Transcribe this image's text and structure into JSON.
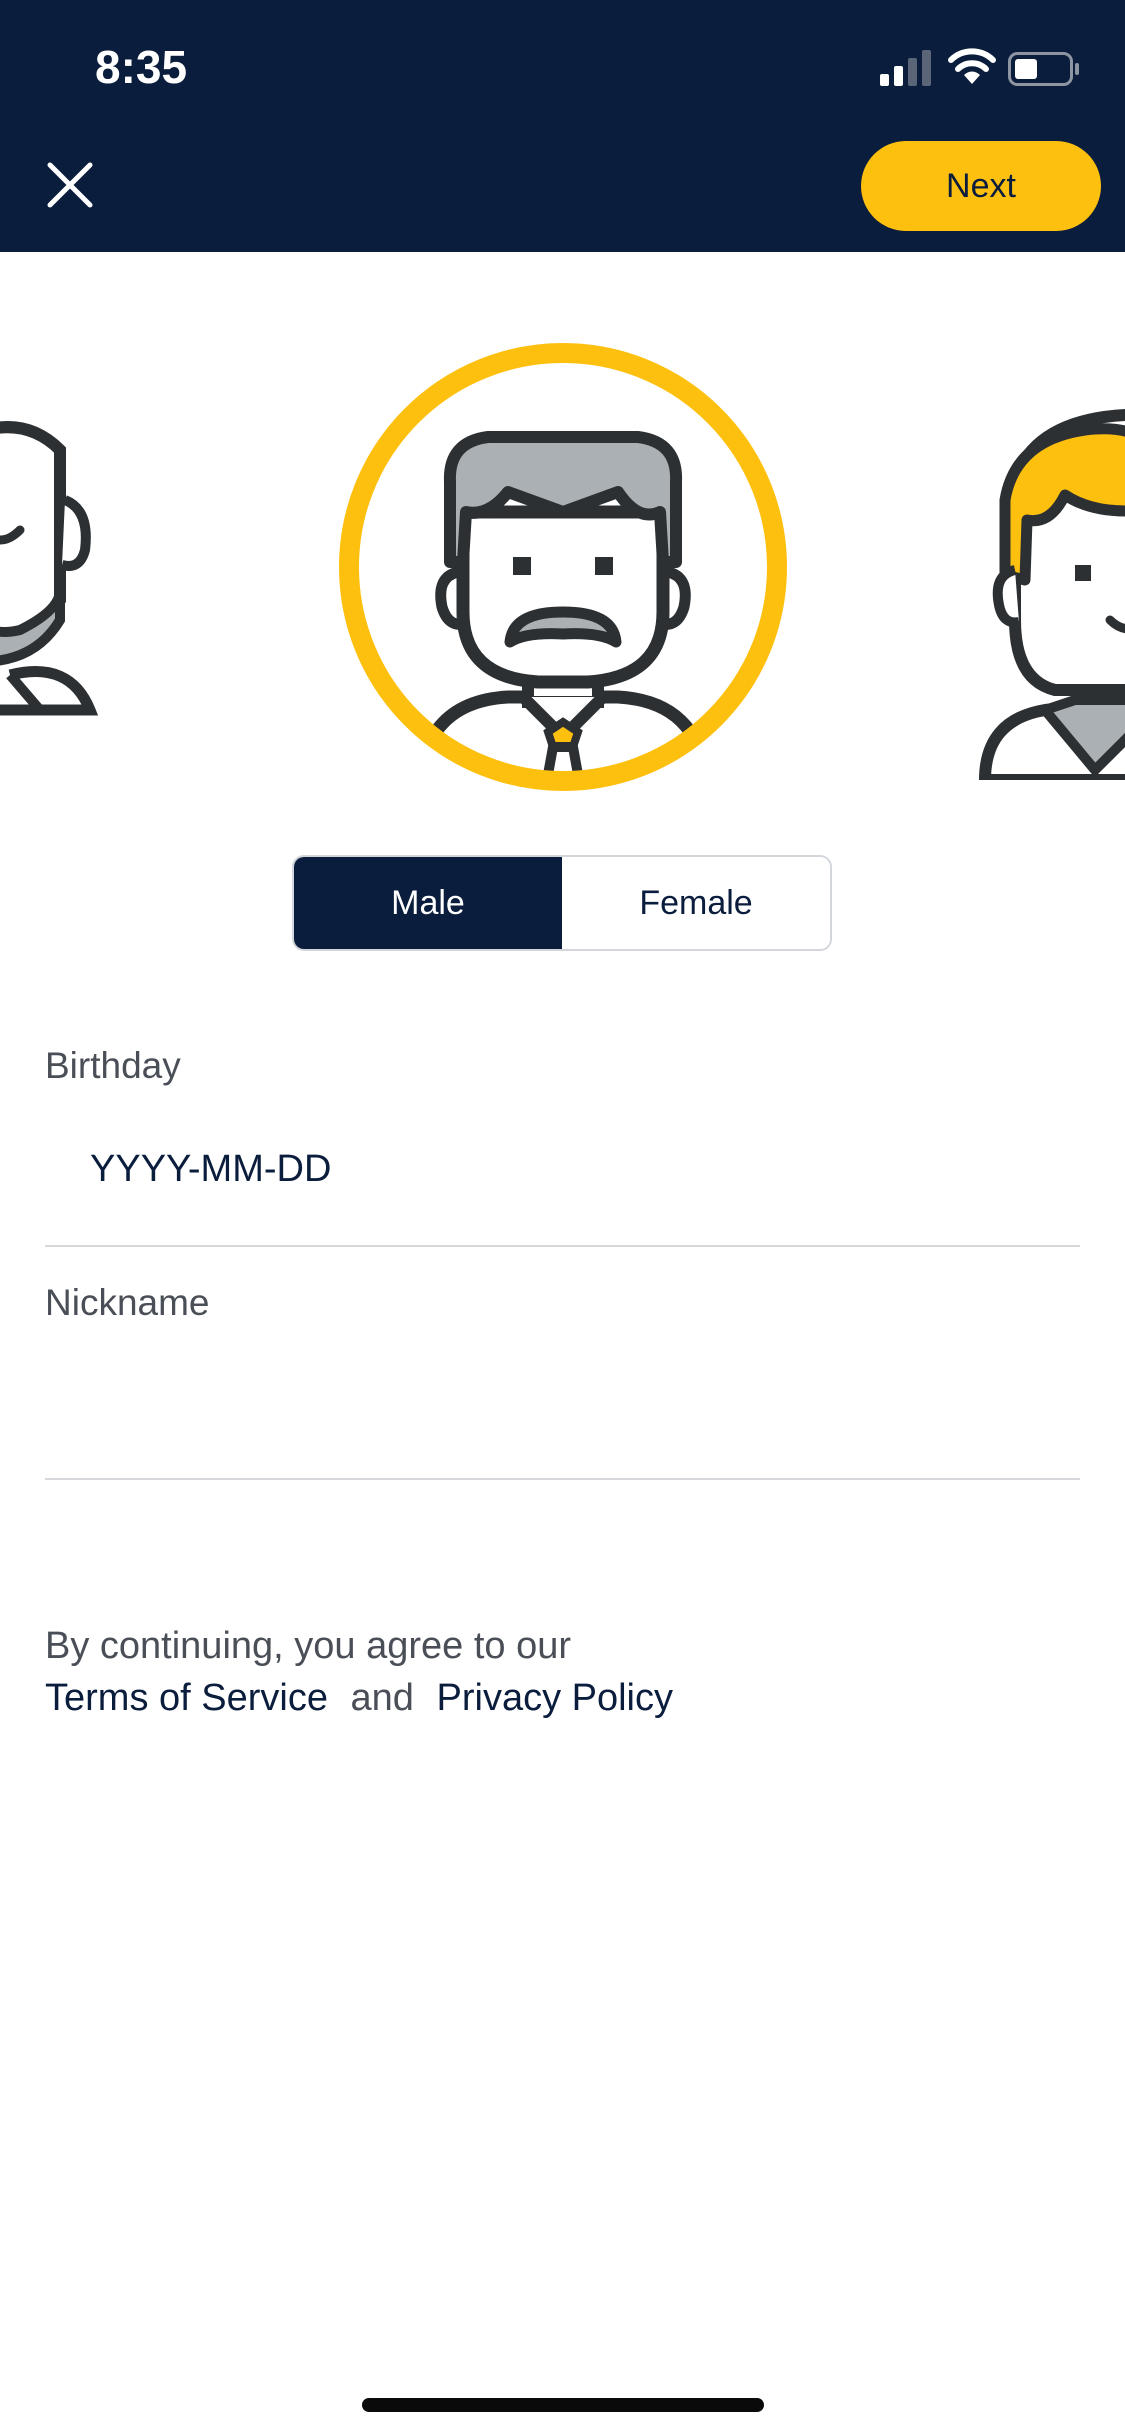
{
  "status_bar": {
    "time": "8:35"
  },
  "header": {
    "next_label": "Next"
  },
  "colors": {
    "navy": "#0b1d3c",
    "accent": "#fec00f",
    "hair_gray": "#aab0b3"
  },
  "avatars": {
    "left": "bald-bearded-man-avatar",
    "selected": "mustache-man-avatar",
    "right": "blond-man-avatar"
  },
  "gender": {
    "options": [
      "Male",
      "Female"
    ],
    "selected": "Male"
  },
  "birthday": {
    "label": "Birthday",
    "placeholder": "YYYY-MM-DD",
    "value": ""
  },
  "nickname": {
    "label": "Nickname",
    "placeholder": "",
    "value": ""
  },
  "terms": {
    "prefix": "By continuing, you agree to our",
    "terms_link": "Terms of Service",
    "joiner": "and",
    "privacy_link": "Privacy Policy"
  }
}
